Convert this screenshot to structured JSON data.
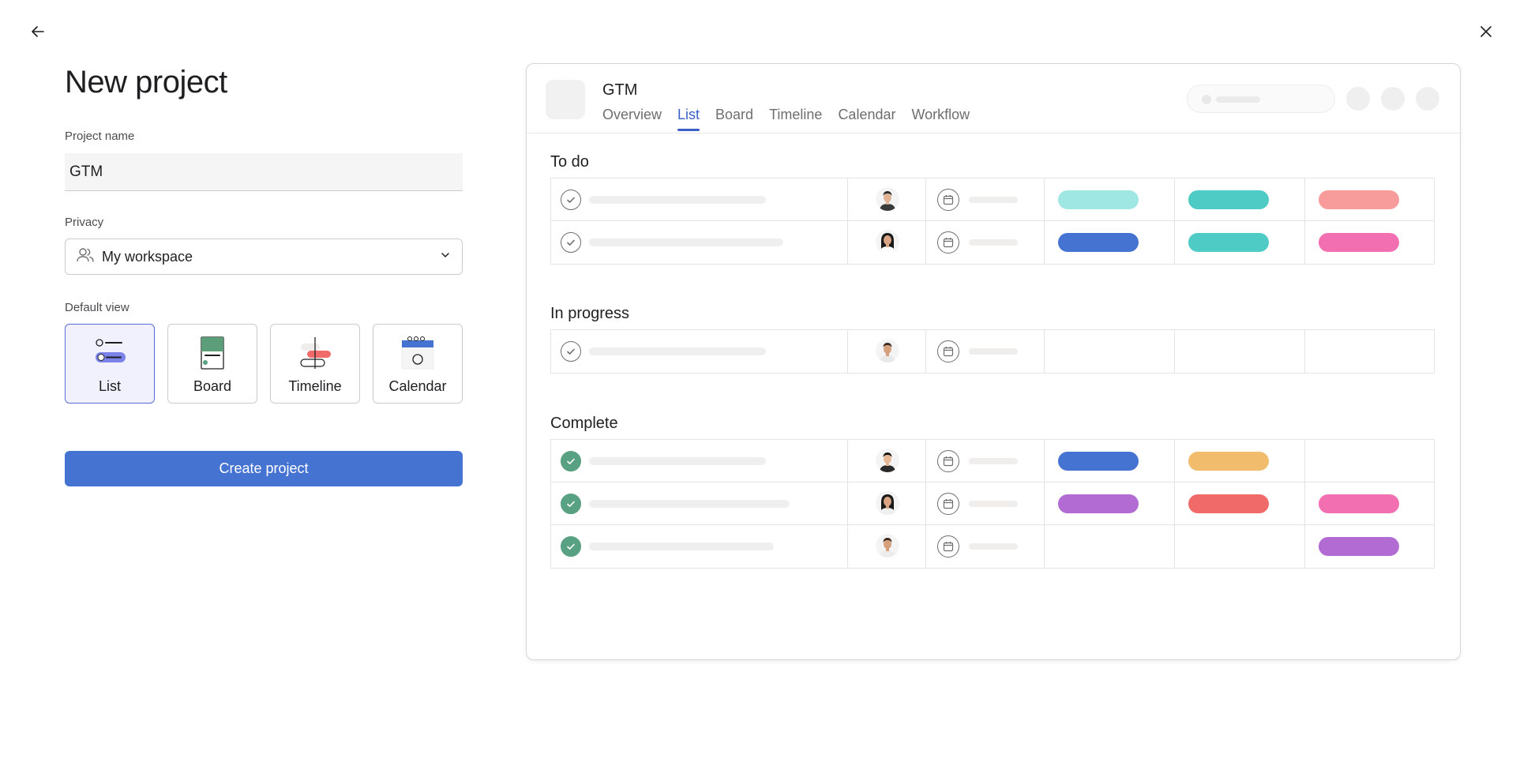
{
  "page": {
    "title": "New project"
  },
  "form": {
    "project_name_label": "Project name",
    "project_name_value": "GTM",
    "privacy_label": "Privacy",
    "privacy_value": "My workspace",
    "default_view_label": "Default view",
    "views": [
      {
        "label": "List",
        "selected": true
      },
      {
        "label": "Board",
        "selected": false
      },
      {
        "label": "Timeline",
        "selected": false
      },
      {
        "label": "Calendar",
        "selected": false
      }
    ],
    "create_label": "Create project"
  },
  "preview": {
    "title": "GTM",
    "tabs": [
      "Overview",
      "List",
      "Board",
      "Timeline",
      "Calendar",
      "Workflow"
    ],
    "active_tab": "List",
    "sections": [
      {
        "name": "To do",
        "rows": [
          {
            "done": false,
            "pills": [
              "#9fe7e3",
              "#4ecbc4",
              "#f89b9b"
            ]
          },
          {
            "done": false,
            "pills": [
              "#4573d2",
              "#4ecbc4",
              "#f26fb2"
            ]
          }
        ]
      },
      {
        "name": "In progress",
        "rows": [
          {
            "done": false,
            "pills": [
              null,
              null,
              null
            ]
          }
        ]
      },
      {
        "name": "Complete",
        "rows": [
          {
            "done": true,
            "pills": [
              "#4573d2",
              "#f1bd6c",
              null
            ]
          },
          {
            "done": true,
            "pills": [
              "#b36bd4",
              "#f06a6a",
              "#f26fb2"
            ]
          },
          {
            "done": true,
            "pills": [
              null,
              null,
              "#b36bd4"
            ]
          }
        ]
      }
    ]
  },
  "colors": {
    "accent": "#4573d2",
    "done_green": "#58a182",
    "selected_card_bg": "#f0f1fc"
  },
  "icons": {
    "back": "arrow-left-icon",
    "close": "close-icon",
    "privacy": "people-icon",
    "dropdown": "chevron-down-icon"
  }
}
